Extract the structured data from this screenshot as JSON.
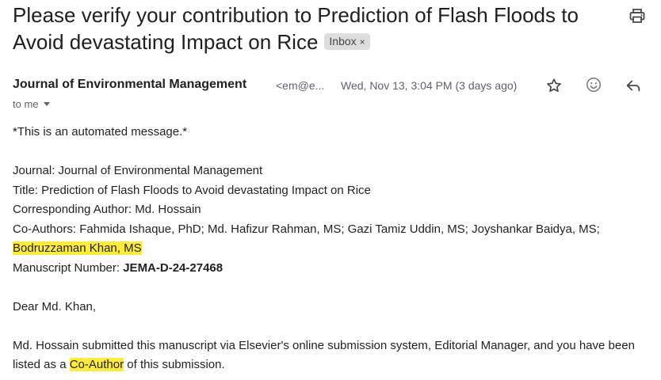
{
  "email": {
    "subject": "Please verify your contribution to Prediction of Flash Floods to Avoid devastating Impact on Rice",
    "label": "Inbox",
    "label_remove": "×",
    "sender_name": "Journal of Environmental Management",
    "sender_email": "<em@e...",
    "date": "Wed, Nov 13, 3:04 PM (3 days ago)",
    "to": "to me",
    "icons": [
      "print-icon",
      "star-icon",
      "emoji-icon",
      "reply-icon",
      "chevron-down-icon"
    ],
    "highlight_color": "#ffeb3b"
  },
  "body": {
    "automated": "*This is an automated message.*",
    "journal": "Journal: Journal of Environmental Management",
    "title": "Title: Prediction of Flash Floods to Avoid devastating Impact on Rice",
    "corresponding": "Corresponding Author: Md. Hossain",
    "coauthors_prefix": "Co-Authors: Fahmida Ishaque, PhD; Md. Hafizur Rahman, MS; Gazi Tamiz Uddin, MS; Joyshankar Baidya, MS;",
    "coauthors_highlight": "Bodruzzaman Khan, MS",
    "manuscript_label": "Manuscript Number:",
    "manuscript_number": "JEMA-D-24-27468",
    "greeting": "Dear Md. Khan,",
    "para_start": "Md. Hossain submitted this manuscript via Elsevier's online submission system, Editorial Manager, and you have been listed as a",
    "para_highlight": "Co-Author",
    "para_end": "of this submission."
  }
}
